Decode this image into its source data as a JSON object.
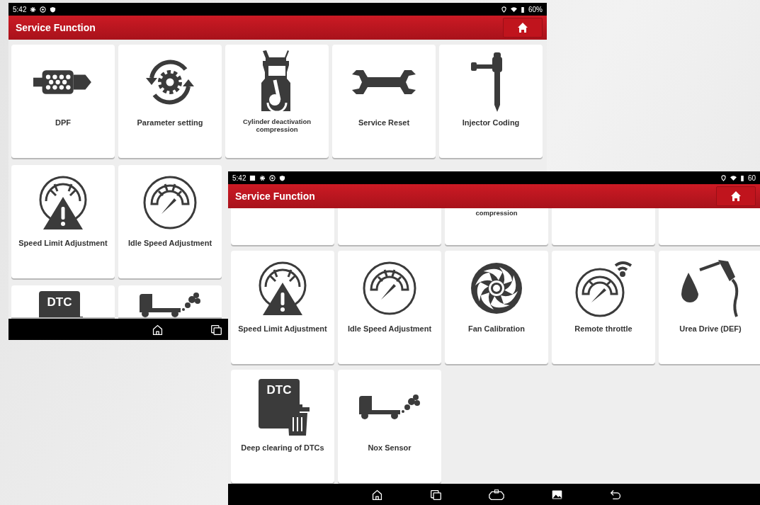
{
  "windows": [
    {
      "on_top": false,
      "status_bar": {
        "time": "5:42",
        "image_notification": false,
        "battery": "60%"
      },
      "header": {
        "title": "Service Function"
      },
      "rows": [
        {
          "items": [
            {
              "kind": "dpf",
              "label": "DPF"
            },
            {
              "kind": "gear-arrows",
              "label": "Parameter setting"
            },
            {
              "kind": "cylinder",
              "label": "Cylinder deactivation compression",
              "small": true
            },
            {
              "kind": "wrench",
              "label": "Service Reset"
            },
            {
              "kind": "injector",
              "label": "Injector Coding"
            }
          ]
        },
        {
          "items": [
            {
              "kind": "gauge-warning",
              "label": "Speed Limit Adjustment"
            },
            {
              "kind": "gauge",
              "label": "Idle Speed Adjustment"
            }
          ]
        },
        {
          "clipped_bottom": true,
          "items": [
            {
              "kind": "dtc",
              "icon_text": "DTC"
            },
            {
              "kind": "truck"
            }
          ]
        }
      ],
      "nav": [
        {
          "kind": "home"
        },
        {
          "kind": "recents"
        }
      ]
    },
    {
      "on_top": true,
      "status_bar": {
        "time": "5:42",
        "image_notification": true,
        "battery": "60"
      },
      "header": {
        "title": "Service Function"
      },
      "rows": [
        {
          "clipped_top": true,
          "items": [
            {
              "kind": "blank"
            },
            {
              "kind": "blank"
            },
            {
              "kind": "blank",
              "label": "compression",
              "small": true
            },
            {
              "kind": "blank"
            },
            {
              "kind": "blank"
            }
          ]
        },
        {
          "items": [
            {
              "kind": "gauge-warning",
              "label": "Speed Limit Adjustment"
            },
            {
              "kind": "gauge",
              "label": "Idle Speed Adjustment"
            },
            {
              "kind": "fan",
              "label": "Fan Calibration"
            },
            {
              "kind": "gauge-wifi",
              "label": "Remote throttle"
            },
            {
              "kind": "fuel",
              "label": "Urea Drive (DEF)"
            }
          ]
        },
        {
          "items": [
            {
              "kind": "dtc",
              "icon_text": "DTC",
              "label": "Deep clearing of DTCs"
            },
            {
              "kind": "truck",
              "label": "Nox Sensor"
            }
          ]
        }
      ],
      "nav": [
        {
          "kind": "home"
        },
        {
          "kind": "recents"
        },
        {
          "kind": "vci"
        },
        {
          "kind": "gallery"
        },
        {
          "kind": "back"
        }
      ]
    }
  ]
}
